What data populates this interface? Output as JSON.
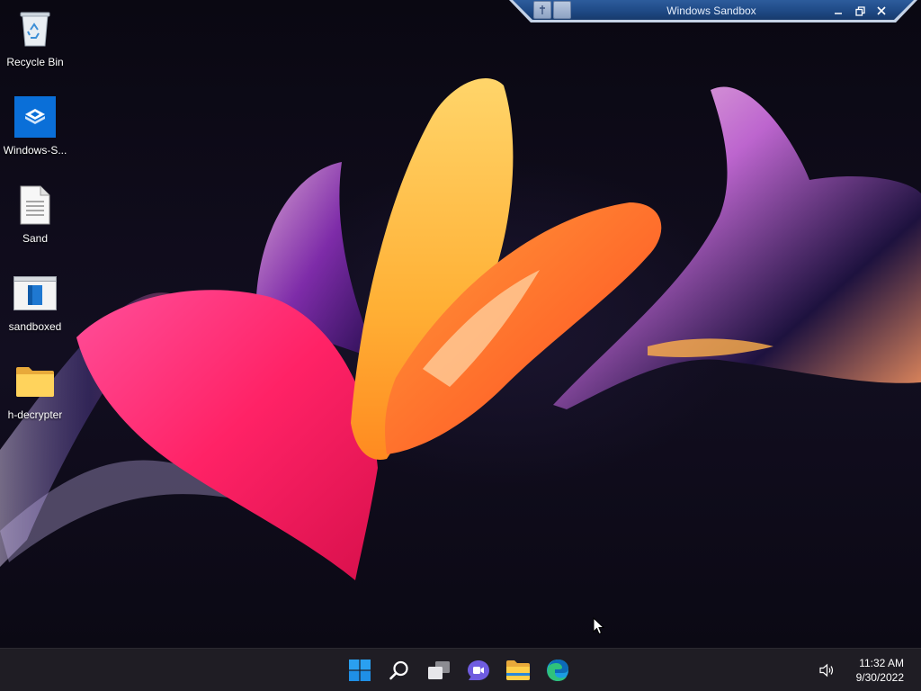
{
  "window": {
    "title": "Windows Sandbox",
    "controls": {
      "minimize_icon": "minimize-icon",
      "restore_icon": "restore-icon",
      "close_icon": "close-icon"
    },
    "pin_icons": [
      "pin-icon",
      "window-icon"
    ]
  },
  "desktop": {
    "icons": [
      {
        "label": "Recycle Bin",
        "icon": "recycle-bin-icon"
      },
      {
        "label": "Windows-S...",
        "icon": "windows-sandbox-icon"
      },
      {
        "label": "Sand",
        "icon": "text-file-icon"
      },
      {
        "label": "sandboxed",
        "icon": "window-app-icon"
      },
      {
        "label": "h-decrypter",
        "icon": "folder-icon"
      }
    ]
  },
  "taskbar": {
    "apps": [
      {
        "name": "Start",
        "icon": "windows-logo-icon"
      },
      {
        "name": "Search",
        "icon": "search-icon"
      },
      {
        "name": "Task View",
        "icon": "task-view-icon"
      },
      {
        "name": "Chat",
        "icon": "chat-icon"
      },
      {
        "name": "File Explorer",
        "icon": "folder-icon"
      },
      {
        "name": "Microsoft Edge",
        "icon": "edge-icon"
      }
    ],
    "tray": {
      "volume_icon": "speaker-icon",
      "time": "11:32 AM",
      "date": "9/30/2022"
    }
  },
  "colors": {
    "accent": "#0078d4",
    "taskbar_bg": "#1f1d24",
    "sandbox_bar": "#9fb4d6"
  }
}
